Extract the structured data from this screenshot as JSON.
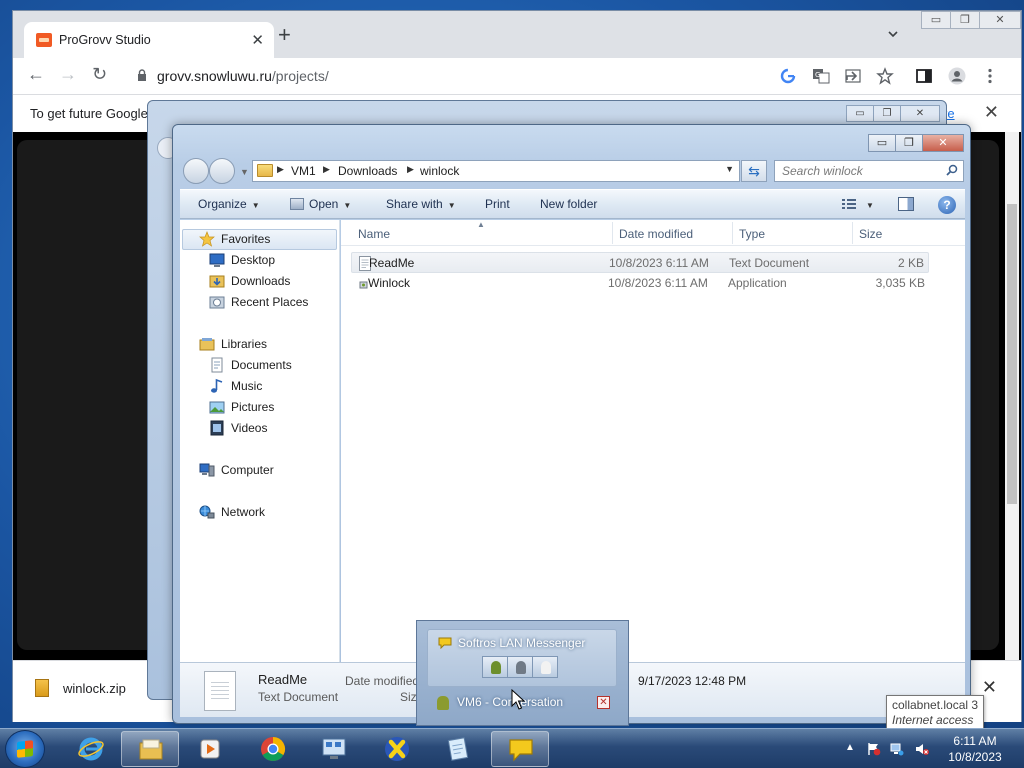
{
  "chrome": {
    "tab_title": "ProGrovv Studio",
    "url_host": "grovv.snowluwu.ru",
    "url_path": "/projects/",
    "infobar_text": "To get future Google",
    "infobar_link": "re",
    "download_filename": "winlock.zip"
  },
  "explorer": {
    "breadcrumb": [
      "VM1",
      "Downloads",
      "winlock"
    ],
    "search_placeholder": "Search winlock",
    "commands": {
      "organize": "Organize",
      "open": "Open",
      "share_with": "Share with",
      "print": "Print",
      "new_folder": "New folder"
    },
    "nav": {
      "favorites": "Favorites",
      "desktop": "Desktop",
      "downloads": "Downloads",
      "recent_places": "Recent Places",
      "libraries": "Libraries",
      "documents": "Documents",
      "music": "Music",
      "pictures": "Pictures",
      "videos": "Videos",
      "computer": "Computer",
      "network": "Network"
    },
    "columns": {
      "name": "Name",
      "date_modified": "Date modified",
      "type": "Type",
      "size": "Size"
    },
    "files": [
      {
        "name": "ReadMe",
        "date_modified": "10/8/2023 6:11 AM",
        "type": "Text Document",
        "size": "2 KB"
      },
      {
        "name": "Winlock",
        "date_modified": "10/8/2023 6:11 AM",
        "type": "Application",
        "size": "3,035 KB"
      }
    ],
    "details": {
      "name": "ReadMe",
      "type": "Text Document",
      "date_label": "Date modified",
      "size_label": "Size",
      "date_value": "9/17/2023 12:48 PM"
    }
  },
  "softros": {
    "title": "Softros LAN Messenger",
    "conversation": "VM6 - Conversation"
  },
  "tooltip": {
    "host": "collabnet.local",
    "count": "3",
    "status": "Internet access"
  },
  "taskbar": {
    "time": "6:11 AM",
    "date": "10/8/2023"
  }
}
